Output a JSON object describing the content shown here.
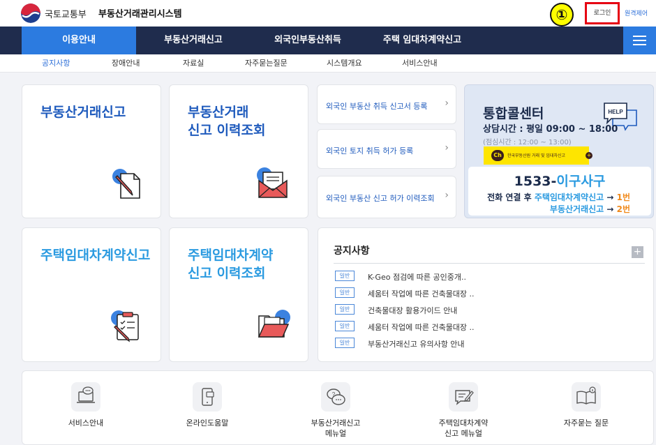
{
  "header": {
    "ministry": "국토교통부",
    "system_name": "부동산거래관리시스템",
    "marker": "①",
    "login": "로그인",
    "remote": "원격제어"
  },
  "main_nav": [
    {
      "label": "이용안내",
      "active": true
    },
    {
      "label": "부동산거래신고",
      "active": false
    },
    {
      "label": "외국인부동산취득",
      "active": false
    },
    {
      "label": "주택 임대차계약신고",
      "active": false
    }
  ],
  "sub_nav": [
    {
      "label": "공지사항",
      "active": true
    },
    {
      "label": "장애안내",
      "active": false
    },
    {
      "label": "자료실",
      "active": false
    },
    {
      "label": "자주묻는질문",
      "active": false
    },
    {
      "label": "시스템개요",
      "active": false
    },
    {
      "label": "서비스안내",
      "active": false
    }
  ],
  "cards": {
    "report": "부동산거래신고",
    "report_history": "부동산거래\n신고 이력조회",
    "lease_report": "주택임대차계약신고",
    "lease_history": "주택임대차계약\n신고 이력조회"
  },
  "foreign_links": [
    "외국인 부동산 취득 신고서 등록",
    "외국인 토지 취득 허가 등록",
    "외국인 부동산 신고 허가 이력조회"
  ],
  "call_center": {
    "title": "통합콜센터",
    "hours": "상담시간 : 평일 09:00 ~ 18:00",
    "break": "(점심시간 : 12:00 ~ 13:00)",
    "kakao_ch": "Ch",
    "kakao_text": "한국부동산원 거래 및 임대차신고",
    "kakao_plus": "+",
    "help_bubble": "HELP",
    "phone_prefix": "1533-",
    "phone_accent": "이구사구",
    "line1_prefix": "전화 연결 후 ",
    "line1_highlight": "주택임대차계약신고",
    "line1_arrow": " → ",
    "line1_num": "1번",
    "line2_text": "부동산거래신고",
    "line2_arrow": " → ",
    "line2_num": "2번"
  },
  "notice": {
    "title": "공지사항",
    "plus": "+",
    "items": [
      {
        "badge": "일반",
        "text": "K-Geo 점검에 따른 공인중개.."
      },
      {
        "badge": "일반",
        "text": "세움터 작업에 따른 건축물대장 .."
      },
      {
        "badge": "일반",
        "text": "건축물대장 활용가이드 안내"
      },
      {
        "badge": "일반",
        "text": "세움터 작업에 따른 건축물대장 .."
      },
      {
        "badge": "일반",
        "text": "부동산거래신고 유의사항 안내"
      }
    ]
  },
  "bottom_links": [
    {
      "label": "서비스안내",
      "icon": "laptop-chat-icon"
    },
    {
      "label": "온라인도움말",
      "icon": "mobile-help-icon"
    },
    {
      "label": "부동산거래신고\n메뉴얼",
      "icon": "chat-question-icon"
    },
    {
      "label": "주택임대차계약\n신고 메뉴얼",
      "icon": "chat-pen-icon"
    },
    {
      "label": "자주묻는 질문",
      "icon": "book-info-icon"
    }
  ],
  "colors": {
    "nav_bg": "#1f2c4d",
    "active_blue": "#2c7be0",
    "title_blue": "#1f5bbd",
    "light_blue": "#2a9ae0",
    "orange": "#f08a1c",
    "login_border": "#e60012",
    "kakao_yellow": "#fee500"
  }
}
